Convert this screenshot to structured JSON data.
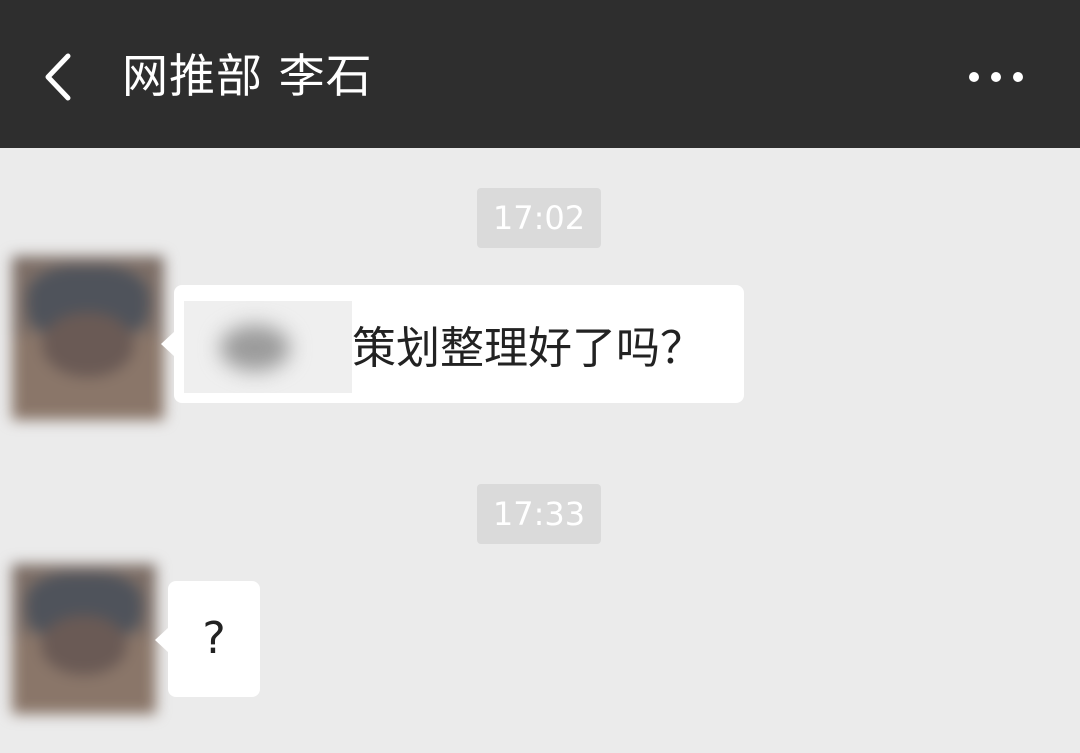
{
  "header": {
    "title": "网推部 李石",
    "back_icon": "chevron-left-icon",
    "more_icon": "more-horizontal-icon"
  },
  "messages": [
    {
      "time": "17:02",
      "avatar": "blurred-avatar",
      "sticker": "blurred-sticker",
      "text": "策划整理好了吗？"
    },
    {
      "time": "17:33",
      "avatar": "blurred-avatar",
      "text": "?"
    }
  ],
  "colors": {
    "header_bg": "#2e2e2e",
    "chat_bg": "#ebebeb",
    "bubble_bg": "#ffffff",
    "time_badge_bg": "#dadada",
    "text_dark": "#222222",
    "text_white": "#ffffff"
  }
}
